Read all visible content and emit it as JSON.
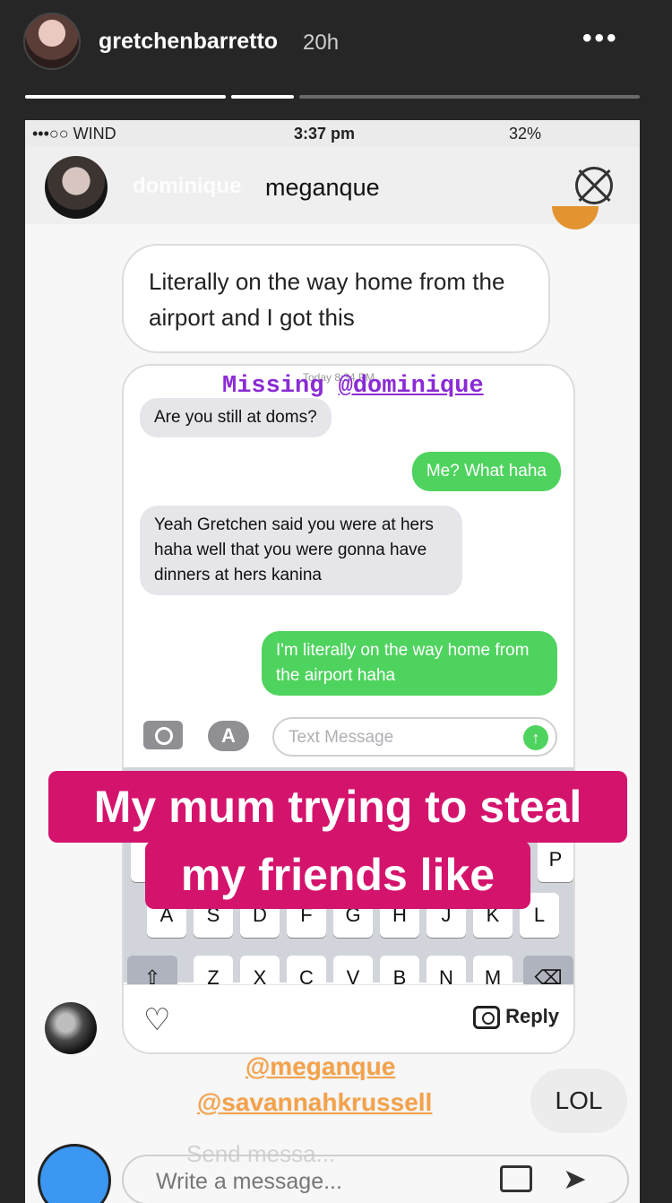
{
  "story": {
    "username": "gretchenbarretto",
    "time": "20h",
    "more": "•••"
  },
  "status_bar": {
    "carrier": "•••○○ WIND",
    "time": "3:37 pm",
    "battery": "32%"
  },
  "inner_header": {
    "ghost_name": "dominique",
    "name": "meganque"
  },
  "quoted_message": "Literally on the way home from the airport and I got this",
  "imessage": {
    "date": "Today 8:34 PM",
    "mention_prefix": "Missing ",
    "mention_handle": "@dominique",
    "messages": [
      {
        "from": "them",
        "text": "Are you still at doms?"
      },
      {
        "from": "me",
        "text": "Me? What haha"
      },
      {
        "from": "them",
        "text": "Yeah Gretchen said you were at hers haha well that you were gonna have dinners at hers kanina"
      },
      {
        "from": "me",
        "text": "I'm literally on the way home from the airport haha"
      }
    ],
    "input_placeholder": "Text Message",
    "appstore_glyph": "A",
    "send_glyph": "↑",
    "keys_row2": [
      "A",
      "S",
      "D",
      "F",
      "G",
      "H",
      "J",
      "K",
      "L"
    ],
    "keys_row3": [
      "Z",
      "X",
      "C",
      "V",
      "B",
      "N",
      "M"
    ],
    "key_p": "P",
    "key_shift": "⇧",
    "key_delete": "⌫"
  },
  "reply_bar": {
    "heart_glyph": "♡",
    "reply_label": "Reply"
  },
  "caption": {
    "line1": "My mum trying to steal",
    "line2": "my friends like"
  },
  "tags": [
    "@meganque",
    "@savannahkrussell"
  ],
  "lol": "LOL",
  "bottom": {
    "write_placeholder": "Write a message...",
    "send_ghost": "Send messa...",
    "send_glyph": "➤"
  },
  "colors": {
    "caption_bg": "#d4136d",
    "mention": "#8b2bd4",
    "tag": "#f4a24a",
    "imessage_green": "#4fd35f"
  }
}
